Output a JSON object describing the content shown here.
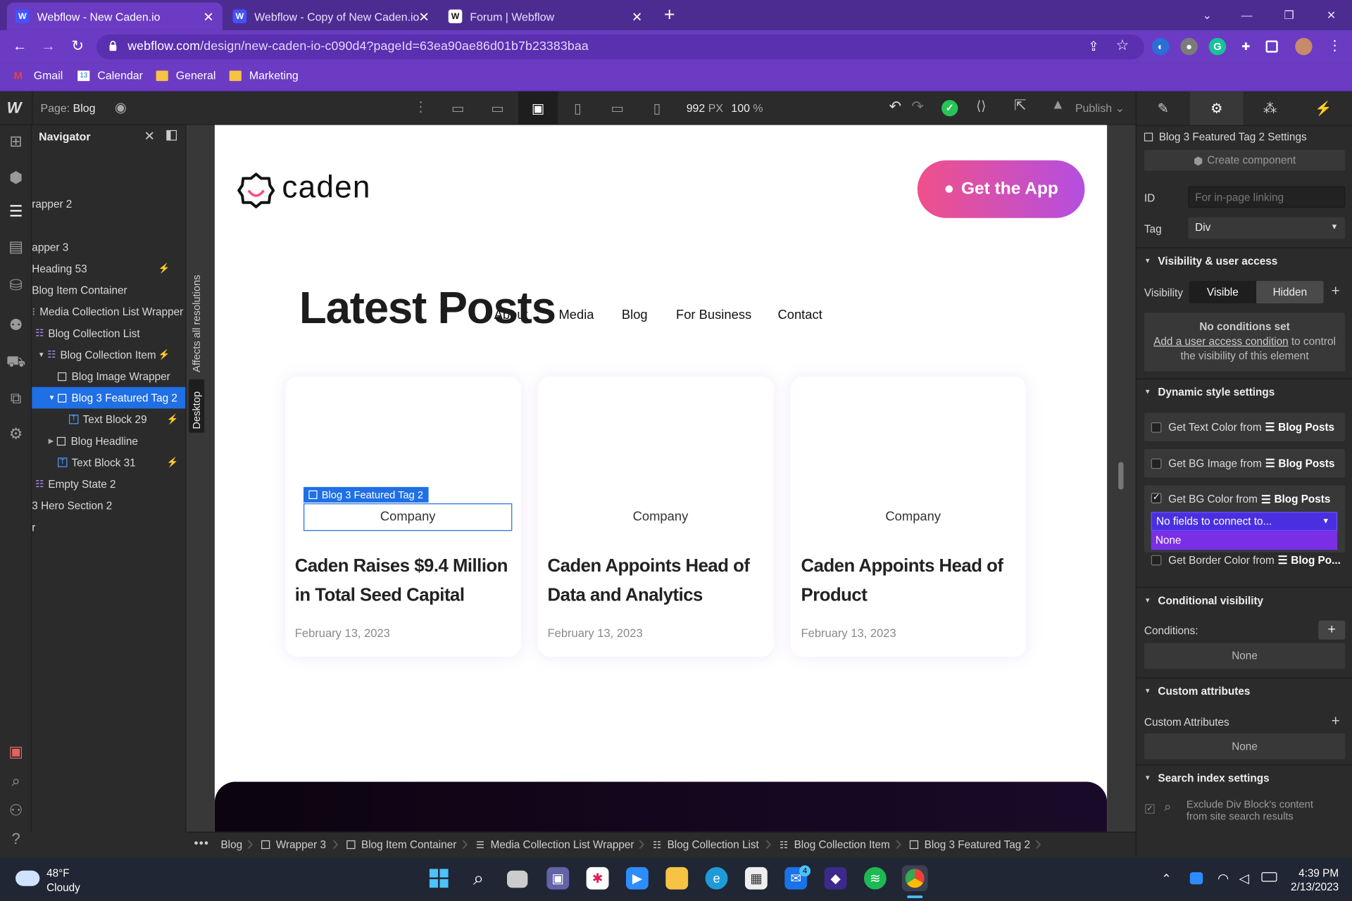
{
  "browser": {
    "tabs": [
      {
        "title": "Webflow - New Caden.io",
        "favicon": "W"
      },
      {
        "title": "Webflow - Copy of New Caden.io",
        "favicon": "W"
      },
      {
        "title": "Forum | Webflow",
        "favicon": "W"
      }
    ],
    "url_host": "webflow.com",
    "url_path": "/design/new-caden-io-c090d4?pageId=63ea90ae86d01b7b23383baa",
    "bookmarks": [
      "Gmail",
      "Calendar",
      "General",
      "Marketing"
    ],
    "calendar_icon_text": "13"
  },
  "designer": {
    "page_label": "Page:",
    "page_name": "Blog",
    "width_value": "992",
    "width_unit": "PX",
    "zoom_value": "100",
    "zoom_unit": "%",
    "publish_label": "Publish",
    "vertical_affects": "Affects all resolutions",
    "vertical_device": "Desktop"
  },
  "navigator": {
    "title": "Navigator",
    "items": [
      {
        "label": "rapper 2"
      },
      {
        "label": "apper 3"
      },
      {
        "label": "Heading 53"
      },
      {
        "label": "Blog Item Container"
      },
      {
        "label": "Media Collection List Wrapper"
      },
      {
        "label": "Blog Collection List"
      },
      {
        "label": "Blog Collection Item"
      },
      {
        "label": "Blog Image Wrapper"
      },
      {
        "label": "Blog 3 Featured Tag 2"
      },
      {
        "label": "Text Block 29"
      },
      {
        "label": "Blog Headline"
      },
      {
        "label": "Text Block 31"
      },
      {
        "label": "Empty State 2"
      },
      {
        "label": "3 Hero Section 2"
      },
      {
        "label": "r"
      }
    ]
  },
  "site": {
    "logo_text": "caden",
    "nav": [
      "About",
      "Media",
      "Blog",
      "For Business",
      "Contact"
    ],
    "cta": "Get the App",
    "heading": "Latest Posts",
    "selected_label": "Blog 3 Featured Tag 2",
    "cards": [
      {
        "category": "Company",
        "title_line1": "Caden Raises $9.4 Million",
        "title_line2": "in Total Seed Capital",
        "date": "February 13, 2023"
      },
      {
        "category": "Company",
        "title_line1": "Caden Appoints Head of",
        "title_line2": "Data and Analytics",
        "date": "February 13, 2023"
      },
      {
        "category": "Company",
        "title_line1": "Caden Appoints Head of",
        "title_line2": "Product",
        "date": "February 13, 2023"
      }
    ]
  },
  "settings": {
    "element_title": "Blog 3 Featured Tag 2 Settings",
    "create_component": "Create component",
    "id_label": "ID",
    "id_placeholder": "For in-page linking",
    "tag_label": "Tag",
    "tag_value": "Div",
    "visibility_section": "Visibility & user access",
    "visibility_label": "Visibility",
    "visible_option": "Visible",
    "hidden_option": "Hidden",
    "no_conditions_title": "No conditions set",
    "no_conditions_link": "Add a user access condition",
    "no_conditions_rest": " to control",
    "no_conditions_line2": "the visibility of this element",
    "dynamic_section": "Dynamic style settings",
    "dynamic": [
      {
        "label": "Get Text Color from",
        "source": "Blog Posts",
        "checked": false
      },
      {
        "label": "Get BG Image from",
        "source": "Blog Posts",
        "checked": false
      },
      {
        "label": "Get BG Color from",
        "source": "Blog Posts",
        "checked": true
      },
      {
        "label": "Get Border Color from",
        "source": "Blog Po...",
        "checked": false
      }
    ],
    "dropdown_value": "No fields to connect to...",
    "dropdown_option": "None",
    "conditional_section": "Conditional visibility",
    "conditions_label": "Conditions:",
    "conditions_none": "None",
    "custom_attr_section": "Custom attributes",
    "custom_attr_label": "Custom Attributes",
    "custom_attr_none": "None",
    "search_section": "Search index settings",
    "search_line1": "Exclude Div Block's content",
    "search_line2": "from site search results"
  },
  "breadcrumbs": [
    "Blog",
    "Wrapper 3",
    "Blog Item Container",
    "Media Collection List Wrapper",
    "Blog Collection List",
    "Blog Collection Item",
    "Blog 3 Featured Tag 2"
  ],
  "taskbar": {
    "temp": "48°F",
    "weather": "Cloudy",
    "time": "4:39 PM",
    "date": "2/13/2023",
    "mail_badge": "4"
  }
}
